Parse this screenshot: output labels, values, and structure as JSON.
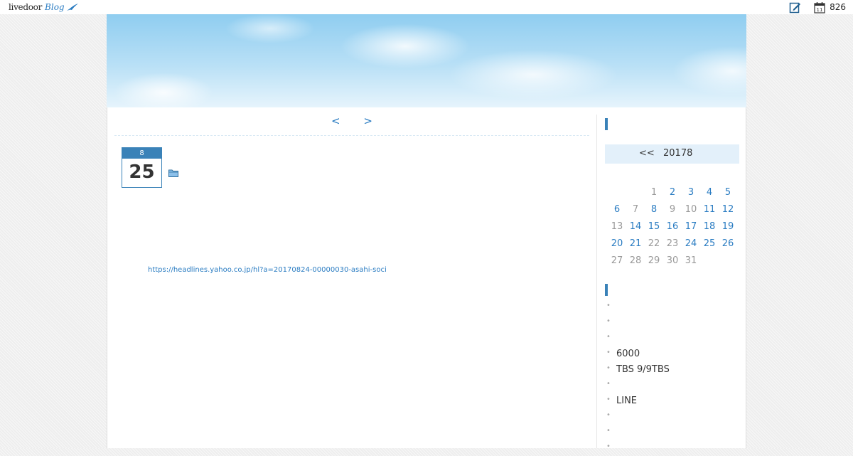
{
  "topbar": {
    "logo_livedoor": "livedoor",
    "logo_blog": "Blog",
    "counter": "826",
    "calendar_icon_day": "11",
    "icons": [
      "edit-icon",
      "calendar-icon"
    ]
  },
  "pager": {
    "prev": "<",
    "next": ">"
  },
  "entry": {
    "month": "8",
    "day": "25",
    "link_text": "https://headlines.yahoo.co.jp/hl?a=20170824-00000030-asahi-soci"
  },
  "sidebar": {
    "calendar": {
      "nav": "<<",
      "title": "20178",
      "weeks": [
        [
          "",
          "",
          "1",
          "2",
          "3",
          "4",
          "5"
        ],
        [
          "6",
          "7",
          "8",
          "9",
          "10",
          "11",
          "12"
        ],
        [
          "13",
          "14",
          "15",
          "16",
          "17",
          "18",
          "19"
        ],
        [
          "20",
          "21",
          "22",
          "23",
          "24",
          "25",
          "26"
        ],
        [
          "27",
          "28",
          "29",
          "30",
          "31",
          "",
          ""
        ]
      ],
      "linked_days": [
        "2",
        "3",
        "4",
        "5",
        "6",
        "8",
        "11",
        "12",
        "14",
        "15",
        "16",
        "17",
        "18",
        "19",
        "20",
        "21",
        "24",
        "25",
        "26"
      ]
    },
    "recent_items": [
      "",
      "",
      "",
      "6000",
      "TBS 9/9TBS",
      "",
      "LINE",
      "",
      "",
      ""
    ]
  },
  "colors": {
    "accent": "#3a82b8",
    "link": "#2a7cc2",
    "calendar_header_bg": "#e3f0fa"
  }
}
